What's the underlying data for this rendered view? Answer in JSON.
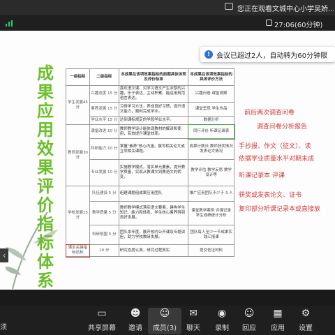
{
  "status_bar": {
    "title": "您正在观看文城中心小学吴娇…的屏",
    "clock": "27:06(60分钟)"
  },
  "notice": {
    "text": "会议已超过2人，自动转为60分钟限"
  },
  "slide": {
    "vertical_title": "成果应用效果评价指标体系",
    "headers": [
      "一级指标",
      "二级指标",
      "本成果在该项效果指标的前期具体体现及评价标准",
      "本成果在该项效果指标的具体评价方法"
    ],
    "rows": [
      {
        "l1": "学生发展45分",
        "l2": "兴趣态度 15 分",
        "desc": "喜欢语文课，对学习语文产生浓厚的兴趣，乐于表达，主动积累，能运用规范语言表达。",
        "ev": "兴趣问卷 课堂观察"
      },
      {
        "l1": "",
        "l2": "素养发展 15 分",
        "desc": "习得学习方法，养成良好习惯，提升语文能力，顺利完成学业。",
        "ev": "课堂呈现 学生作品"
      },
      {
        "l1": "",
        "l2": "学业水平 15 分",
        "desc": "达到课标规定的学段学业水平。",
        "ev": "数据分析"
      },
      {
        "l1": "教师发展30分",
        "l2": "课堂改进 10 分",
        "desc": "教师教学设计能体现教材的解读和使用，有效提升课堂效率。",
        "ev": "同行评价 听课记录表"
      },
      {
        "l1": "",
        "l2": "科研能力 10 分",
        "desc": "掌握\"素养\"核心内涵，撰写相关论文或立项相关课题。",
        "ev": "成果计数法 教师获奖情况发表论文情况"
      },
      {
        "l1": "",
        "l2": "专业发展 10 分",
        "desc": "实施教学模式，落实单元要素，提升教学质量，实现从教课文到教语文的转变。",
        "ev": "教学评估 教学反思 教学设计等"
      },
      {
        "l1": "学校发展15分",
        "l2": "队伍建设 5 分",
        "desc": "组建课题组成果应用团队",
        "ev": "推广应用团队不少于 3 人"
      },
      {
        "l1": "",
        "l2": "教学质量 5 分",
        "desc": "教师教学模式落实语文要素，建构学生知识、能力和体系，学生核心素养得到良好发展。",
        "ev": "课堂教学案例 评课记录 学生成绩统计分析"
      },
      {
        "l1": "",
        "l2": "科研氛围 5 分",
        "desc": "团队本年度，展开校内公开课及专题讲座，助力学校教研发展。",
        "ev": "团队每人至少一节成果实践汇报课"
      }
    ],
    "footer_row": {
      "l1": "满足关键指标达标",
      "l2": "10 分",
      "desc": "研究态度认真，研究过程真实",
      "ev": "提交佐证材料"
    },
    "right_notes": [
      "前后两次调查问卷",
      "调查问卷分析报告",
      "手抄报、作文（征文）、读",
      "依据学业质量水平对期末成",
      "听课记录本    评课",
      "获奖或发表论文、证书",
      "复印部分听课记录本或直接放"
    ]
  },
  "dock": {
    "partial_left": "须",
    "items": [
      "共享屏幕",
      "邀请",
      "成员(3)",
      "聊天",
      "录制",
      "回应",
      "应用",
      "设置"
    ]
  },
  "colors": {
    "title_green": "#6bbf2a",
    "note_red": "#d23a3a",
    "toolbar_bg": "#1f1f1f"
  }
}
